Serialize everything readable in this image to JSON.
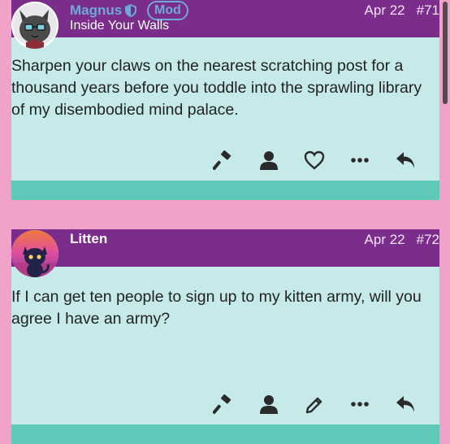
{
  "posts": [
    {
      "username": "Magnus",
      "badge": "Mod",
      "user_title": "Inside Your Walls",
      "date": "Apr 22",
      "post_number": "#71",
      "text": "Sharpen your claws on the nearest scratching post for a thousand years before you toddle into the sprawling library of my disembodied mind palace.",
      "actions": [
        "hammer-icon",
        "user-icon",
        "heart-icon",
        "more-icon",
        "reply-icon"
      ]
    },
    {
      "username": "Litten",
      "user_title": "",
      "date": "Apr 22",
      "post_number": "#72",
      "text": "If I can get ten people to sign up to my kitten army, will you agree I have an army?",
      "actions": [
        "hammer-icon",
        "user-icon",
        "pencil-icon",
        "more-icon",
        "reply-icon"
      ]
    }
  ],
  "colors": {
    "page_bg": "#f2a2c8",
    "header_bg": "#7a2d8a",
    "post_bg": "#c6eaea",
    "footer_bar": "#5fc9b9",
    "mod_accent": "#6fa8dc"
  }
}
